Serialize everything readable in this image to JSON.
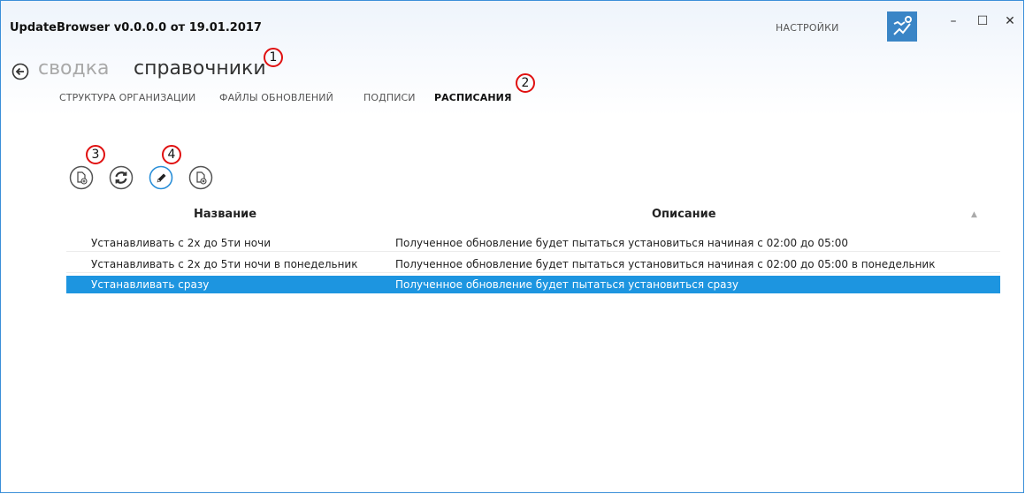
{
  "window": {
    "title": "UpdateBrowser v0.0.0.0 от 19.01.2017",
    "settings_label": "НАСТРОЙКИ",
    "minimize_glyph": "–",
    "maximize_glyph": "☐",
    "close_glyph": "✕"
  },
  "breadcrumb": {
    "previous": "сводка",
    "current": "справочники"
  },
  "tabs": [
    {
      "label": "СТРУКТУРА ОРГАНИЗАЦИИ",
      "active": false
    },
    {
      "label": "ФАЙЛЫ ОБНОВЛЕНИЙ",
      "active": false
    },
    {
      "label": "ПОДПИСИ",
      "active": false
    },
    {
      "label": "РАСПИСАНИЯ",
      "active": true
    }
  ],
  "markers": [
    "1",
    "2",
    "3",
    "4"
  ],
  "toolbar": {
    "buttons": [
      {
        "icon": "add-document-icon"
      },
      {
        "icon": "refresh-icon"
      },
      {
        "icon": "edit-pencil-icon"
      },
      {
        "icon": "delete-document-icon"
      }
    ]
  },
  "table": {
    "columns": [
      "Название",
      "Описание"
    ],
    "sort_glyph": "▲",
    "rows": [
      {
        "name": "Устанавливать с 2х до 5ти ночи",
        "description": "Полученное обновление будет пытаться установиться начиная с 02:00 до 05:00",
        "selected": false
      },
      {
        "name": "Устанавливать с 2х до 5ти ночи в понедельник",
        "description": "Полученное обновление будет пытаться установиться начиная с 02:00 до 05:00 в понедельник",
        "selected": false
      },
      {
        "name": "Устанавливать сразу",
        "description": "Полученное обновление будет пытаться установиться сразу",
        "selected": true
      }
    ]
  },
  "colors": {
    "accent": "#3b8fd9",
    "selection": "#1d95e0",
    "marker": "#e01010"
  }
}
